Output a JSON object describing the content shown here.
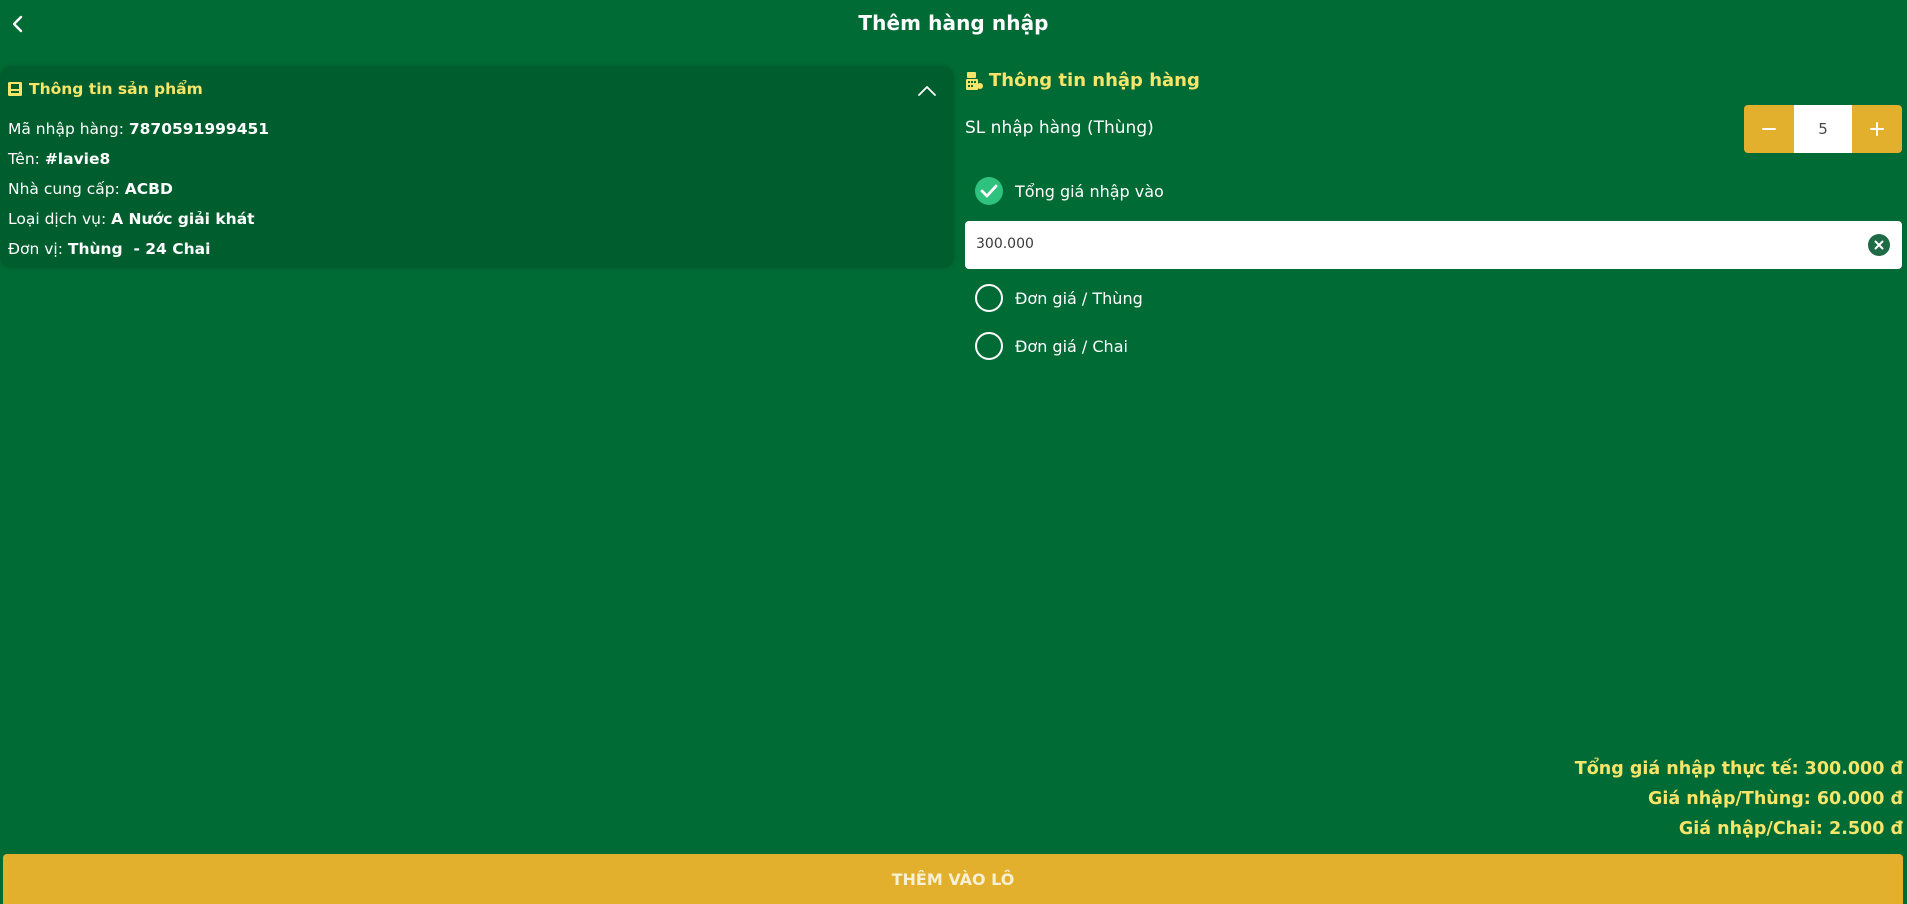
{
  "header": {
    "title": "Thêm hàng nhập"
  },
  "product_info": {
    "title": "Thông tin sản phẩm",
    "rows": [
      {
        "label": "Mã nhập hàng: ",
        "value": "7870591999451"
      },
      {
        "label": "Tên: ",
        "value": "#lavie8"
      },
      {
        "label": "Nhà cung cấp: ",
        "value": "ACBD"
      },
      {
        "label": "Loại dịch vụ: ",
        "value": "A Nước giải khát"
      },
      {
        "label": "Đơn vị: ",
        "value": "Thùng  - 24 Chai"
      }
    ]
  },
  "import_info": {
    "title": "Thông tin nhập hàng",
    "quantity_label": "SL nhập hàng (Thùng)",
    "quantity_value": "5",
    "options": [
      {
        "label": "Tổng giá nhập vào",
        "checked": true
      },
      {
        "label": "Đơn giá / Thùng",
        "checked": false
      },
      {
        "label": "Đơn giá / Chai",
        "checked": false
      }
    ],
    "price_value": "300.000"
  },
  "totals": {
    "total_actual": "Tổng giá nhập thực tế: 300.000 đ",
    "per_case": "Giá nhập/Thùng: 60.000 đ",
    "per_bottle": "Giá nhập/Chai: 2.500 đ"
  },
  "submit_label": "THÊM VÀO LÔ",
  "colors": {
    "background": "#006b35",
    "card": "#005e2e",
    "accent_yellow": "#f7e56a",
    "button": "#e3b02d",
    "checked": "#2ec27e"
  },
  "icons": {
    "back": "chevron-left-icon",
    "collapse": "chevron-up-icon",
    "product": "book-icon",
    "import": "cash-register-icon",
    "minus": "minus-icon",
    "plus": "plus-icon",
    "check": "check-icon",
    "clear": "close-circle-icon"
  }
}
